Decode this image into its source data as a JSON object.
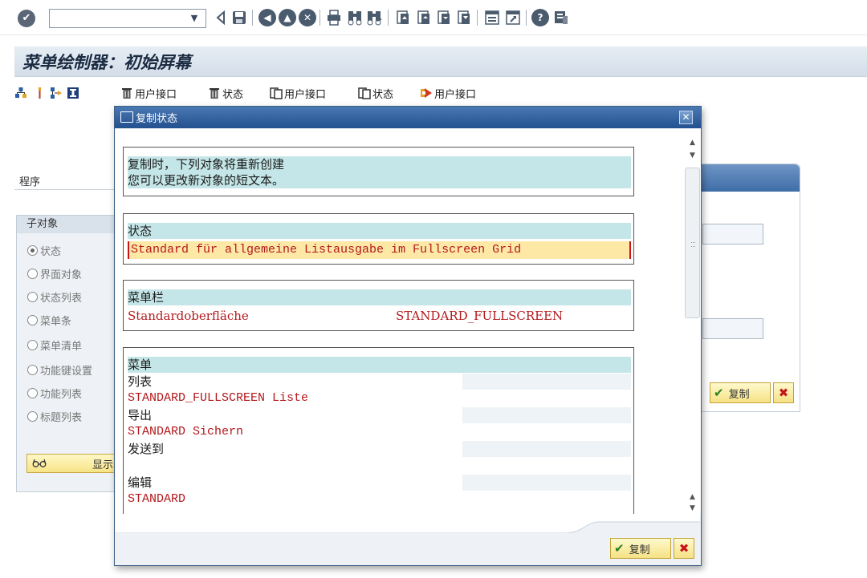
{
  "toolbar": {
    "ok_icon": "check-icon",
    "command_field_value": "",
    "icons": [
      "back-icon",
      "save-icon",
      "back-nav-icon",
      "exit-icon",
      "cancel-icon",
      "print-icon",
      "find-icon",
      "find-next-icon",
      "first-page-icon",
      "previous-page-icon",
      "next-page-icon",
      "last-page-icon",
      "create-session-icon",
      "shortcut-icon",
      "help-icon",
      "customize-layout-icon"
    ]
  },
  "header": {
    "title": "菜单绘制器：初始屏幕"
  },
  "app_toolbar": {
    "items": [
      {
        "icon": "hierarchy-icon",
        "label": ""
      },
      {
        "icon": "pin-icon",
        "label": ""
      },
      {
        "icon": "where-used-icon",
        "label": ""
      },
      {
        "icon": "info-icon",
        "label": ""
      },
      {
        "icon": "trash-icon",
        "label": "用户接口"
      },
      {
        "icon": "trash-icon",
        "label": "状态"
      },
      {
        "icon": "copy-icon",
        "label": "用户接口"
      },
      {
        "icon": "copy-icon",
        "label": "状态"
      },
      {
        "icon": "rename-icon",
        "label": "用户接口"
      }
    ]
  },
  "left_panel": {
    "program_label": "程序",
    "group_title": "子对象",
    "options": [
      {
        "label": "状态",
        "selected": true
      },
      {
        "label": "界面对象",
        "selected": false
      },
      {
        "label": "状态列表",
        "selected": false
      },
      {
        "label": "菜单条",
        "selected": false
      },
      {
        "label": "菜单清单",
        "selected": false
      },
      {
        "label": "功能键设置",
        "selected": false
      },
      {
        "label": "功能列表",
        "selected": false
      },
      {
        "label": "标题列表",
        "selected": false
      }
    ],
    "display_button_label": "显示"
  },
  "right_panel": {
    "copy_button_label": "复制"
  },
  "dialog": {
    "title": "复制状态",
    "info_lines": [
      "复制时，下列对象将重新创建",
      "您可以更改新对象的短文本。"
    ],
    "status_section": {
      "header": "状态",
      "value": "Standard für allgemeine Listausgabe im Fullscreen Grid"
    },
    "menubar_section": {
      "header": "菜单栏",
      "name": "Standardoberfläche",
      "code": "STANDARD_FULLSCREEN"
    },
    "menu_section": {
      "header": "菜单",
      "rows": [
        {
          "text": "列表",
          "style": "black"
        },
        {
          "text": "STANDARD_FULLSCREEN Liste",
          "style": "red"
        },
        {
          "text": "导出",
          "style": "black"
        },
        {
          "text": "STANDARD Sichern",
          "style": "red"
        },
        {
          "text": "发送到",
          "style": "black"
        },
        {
          "text": "",
          "style": "red"
        },
        {
          "text": "编辑",
          "style": "black"
        },
        {
          "text": "STANDARD",
          "style": "red"
        }
      ]
    },
    "copy_button_label": "复制",
    "colors": {
      "title_bar": "#23508e",
      "section_header_bg": "#c5e6e8",
      "input_required_bg": "#fde8a6",
      "value_text": "#b4191d"
    }
  }
}
